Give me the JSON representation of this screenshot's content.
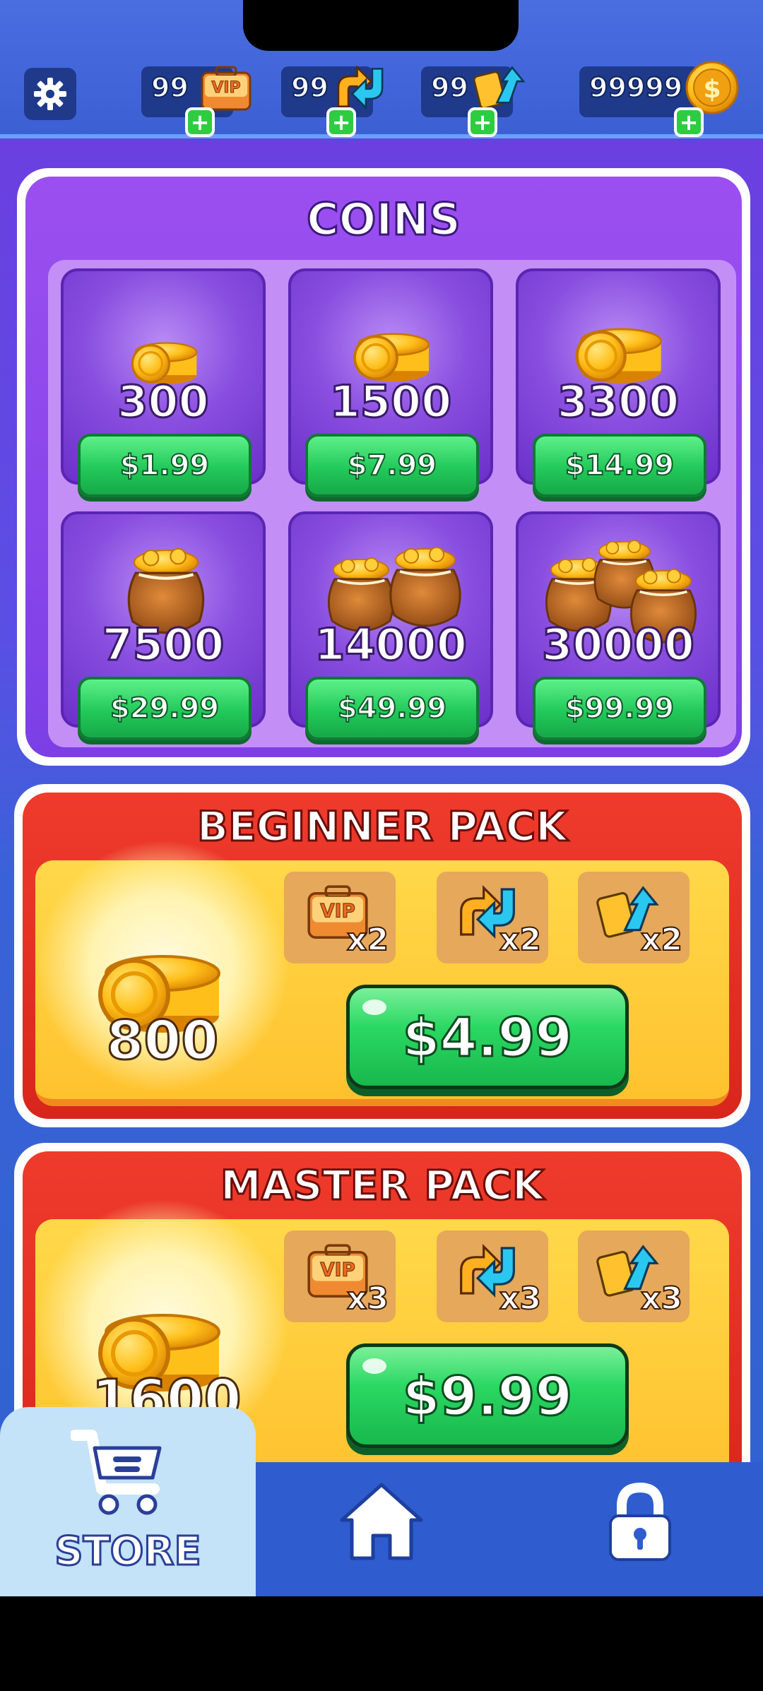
{
  "topbar": {
    "resources": [
      {
        "id": "vip",
        "value": "99",
        "icon": "vip-ticket-icon"
      },
      {
        "id": "arrows",
        "value": "99",
        "icon": "swap-arrows-icon"
      },
      {
        "id": "shuffle",
        "value": "99",
        "icon": "shuffle-cards-icon"
      },
      {
        "id": "coins",
        "value": "99999",
        "icon": "dollar-coin-icon"
      }
    ],
    "vip_label": "VIP",
    "plus_glyph": "+"
  },
  "coins_panel": {
    "title": "COINS",
    "offers": [
      {
        "amount": "300",
        "price": "$1.99"
      },
      {
        "amount": "1500",
        "price": "$7.99"
      },
      {
        "amount": "3300",
        "price": "$14.99"
      },
      {
        "amount": "7500",
        "price": "$29.99"
      },
      {
        "amount": "14000",
        "price": "$49.99"
      },
      {
        "amount": "30000",
        "price": "$99.99"
      }
    ]
  },
  "beginner_pack": {
    "title": "BEGINNER PACK",
    "coins": "800",
    "items": [
      {
        "icon": "vip-ticket-icon",
        "count": "x2"
      },
      {
        "icon": "swap-arrows-icon",
        "count": "x2"
      },
      {
        "icon": "shuffle-cards-icon",
        "count": "x2"
      }
    ],
    "price": "$4.99"
  },
  "master_pack": {
    "title": "MASTER PACK",
    "coins": "1600",
    "items": [
      {
        "icon": "vip-ticket-icon",
        "count": "x3"
      },
      {
        "icon": "swap-arrows-icon",
        "count": "x3"
      },
      {
        "icon": "shuffle-cards-icon",
        "count": "x3"
      }
    ],
    "price": "$9.99"
  },
  "nav": {
    "store_label": "STORE",
    "active": "store"
  },
  "colors": {
    "green_button": "#22c95a",
    "purple_panel": "#7c3fe6",
    "red_pack": "#d8261c",
    "gold_pack_body": "#ffc22e",
    "nav_blue": "#2f5ccf",
    "store_tab": "#c4e2f8"
  }
}
